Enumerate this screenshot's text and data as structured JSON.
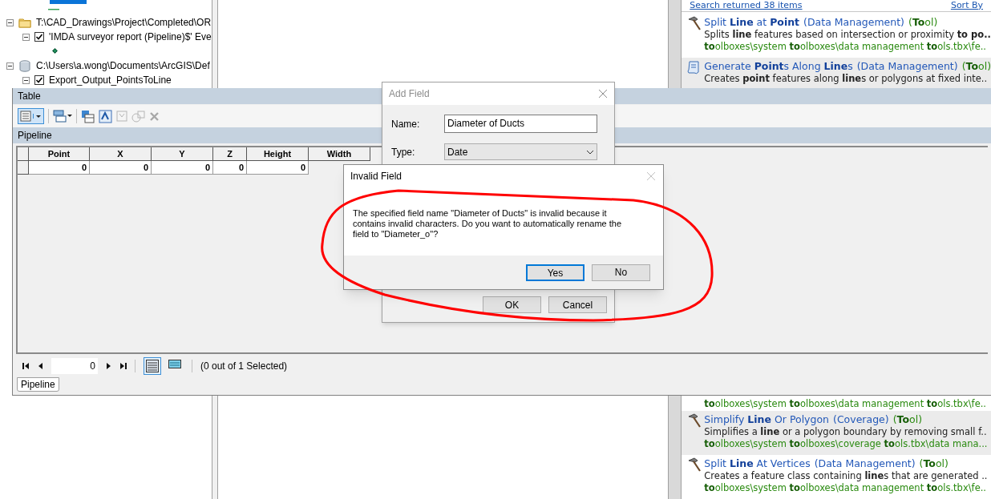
{
  "toc": {
    "items": [
      {
        "kind": "folder",
        "label": "T:\\CAD_Drawings\\Project\\Completed\\OR",
        "expanded": true,
        "children": [
          {
            "label": "'IMDA surveyor report (Pipeline)$' Eve",
            "checked": true,
            "expanded": true,
            "has_point_symbol": true
          }
        ]
      },
      {
        "kind": "database",
        "label": "C:\\Users\\a.wong\\Documents\\ArcGIS\\Def",
        "expanded": true,
        "children": [
          {
            "label": "Export_Output_PointsToLine",
            "checked": true,
            "expanded": true
          }
        ]
      }
    ]
  },
  "search_results": {
    "summary": "Search returned 38 items",
    "sort_label": "Sort By",
    "items": [
      {
        "kind": "tool",
        "highlighted": false,
        "title": "Split **Line** at **Point**",
        "category": "(Data Management)",
        "tool_label": "(**To**ol)",
        "description": "Splits **line** features based on intersection or proximity **to po..**",
        "path": "**to**olboxes\\system **to**olboxes\\data management **to**ols.tbx\\fe.."
      },
      {
        "kind": "script",
        "highlighted": true,
        "title": "Generate **Point**s Along **Line**s",
        "category": "(Data Management)",
        "tool_label": "(**To**ol)",
        "description": "Creates **point** features along **line**s or polygons at fixed inte.."
      }
    ],
    "lower_items": [
      {
        "kind": "path_only",
        "highlighted": false,
        "path": "**to**olboxes\\system **to**olboxes\\data management **to**ols.tbx\\fe.."
      },
      {
        "kind": "tool",
        "highlighted": true,
        "title": "Simplify **Line** Or Polygon",
        "category": "(Coverage)",
        "tool_label": "(**To**ol)",
        "description": "Simplifies a **line** or a polygon boundary by removing small f..",
        "path": "**to**olboxes\\system **to**olboxes\\coverage **to**ols.tbx\\data mana..."
      },
      {
        "kind": "tool",
        "highlighted": false,
        "title": "Split **Line** At Vertices",
        "category": "(Data Management)",
        "tool_label": "(**To**ol)",
        "description": "Creates a feature class containing **line**s that are generated ..",
        "path": "**to**olboxes\\system **to**olboxes\\data management **to**ols.tbx\\fe.."
      }
    ]
  },
  "table_window": {
    "title": "Table",
    "table_name": "Pipeline",
    "columns": [
      "Point",
      "X",
      "Y",
      "Z",
      "Height",
      "Width"
    ],
    "rows": [
      [
        "0",
        "0",
        "0",
        "0",
        "0"
      ]
    ],
    "record": "0",
    "selection_status": "(0 out of 1 Selected)",
    "views": [
      {
        "selected": true
      },
      {
        "selected": false
      }
    ],
    "tabs": [
      {
        "label": "Pipeline"
      }
    ]
  },
  "add_field_dialog": {
    "title": "Add Field",
    "name_label": "Name:",
    "name_value": "Diameter of Ducts",
    "type_label": "Type:",
    "type_value": "Date",
    "buttons": [
      "OK",
      "Cancel"
    ]
  },
  "invalid_field_dialog": {
    "title": "Invalid Field",
    "message": "The specified field name \"Diameter of Ducts\" is invalid because it contains invalid characters. Do you want to automatically rename the field to \"Diameter_o\"?",
    "buttons": [
      {
        "label": "Yes",
        "selected": true
      },
      {
        "label": "No",
        "selected": false
      }
    ]
  }
}
